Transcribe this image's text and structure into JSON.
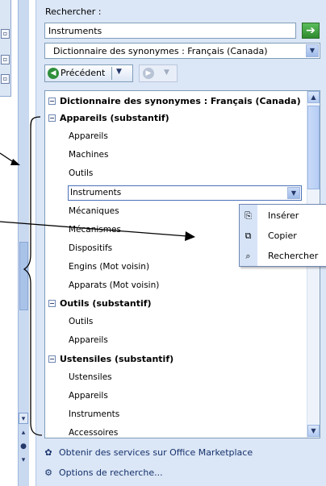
{
  "search": {
    "label": "Rechercher :",
    "value": "Instruments"
  },
  "dictionary": {
    "selected": "Dictionnaire des synonymes : Français (Canada)"
  },
  "nav": {
    "back_label": "Précédent"
  },
  "results": {
    "header": "Dictionnaire des synonymes : Français (Canada)",
    "categories": [
      {
        "title": "Appareils (substantif)",
        "items": [
          "Appareils",
          "Machines",
          "Outils",
          "Instruments",
          "Mécaniques",
          "Mécanismes",
          "Dispositifs",
          "Engins (Mot voisin)",
          "Apparats (Mot voisin)"
        ]
      },
      {
        "title": "Outils (substantif)",
        "items": [
          "Outils",
          "Appareils"
        ]
      },
      {
        "title": "Ustensiles (substantif)",
        "items": [
          "Ustensiles",
          "Appareils",
          "Instruments",
          "Accessoires"
        ]
      }
    ]
  },
  "context_menu": {
    "items": [
      "Insérer",
      "Copier",
      "Rechercher"
    ]
  },
  "footer": {
    "marketplace": "Obtenir des services sur Office Marketplace",
    "options": "Options de recherche..."
  },
  "colors": {
    "pane_bg": "#dbe6f6",
    "border": "#7f9db9",
    "accent": "#4a71b8"
  }
}
